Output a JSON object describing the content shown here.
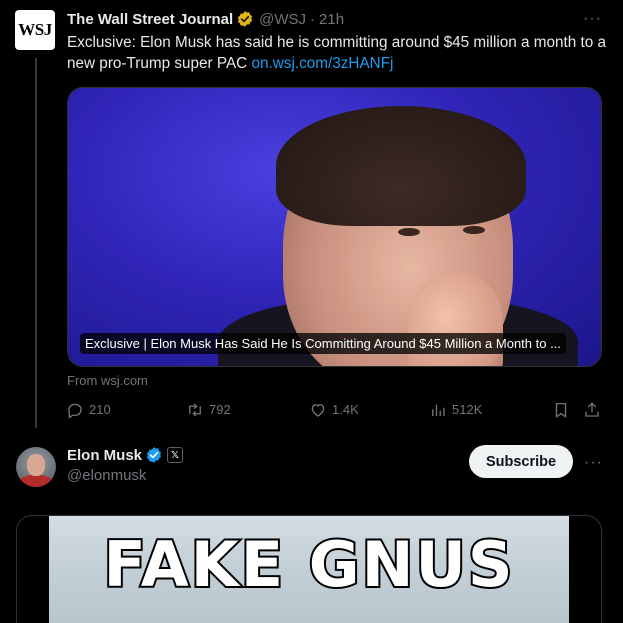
{
  "tweet1": {
    "avatar_text": "WSJ",
    "name": "The Wall Street Journal",
    "handle": "@WSJ",
    "separator": "·",
    "time": "21h",
    "text": "Exclusive: Elon Musk has said he is committing around $45 million a month to a new pro-Trump super PAC ",
    "link": "on.wsj.com/3zHANFj",
    "media_caption": "Exclusive | Elon Musk Has Said He Is Committing Around $45 Million a Month to ...",
    "from": "From wsj.com",
    "actions": {
      "replies": "210",
      "reposts": "792",
      "likes": "1.4K",
      "views": "512K"
    },
    "more": "···"
  },
  "tweet2": {
    "name": "Elon Musk",
    "handle": "@elonmusk",
    "affiliate_badge": "𝕏",
    "subscribe_label": "Subscribe",
    "more": "···",
    "media_text": "FAKE GNUS"
  },
  "colors": {
    "background": "#000000",
    "text": "#e7e9ea",
    "muted": "#71767b",
    "link": "#1d9bf0",
    "verified_gold": "#e2b719",
    "verified_blue": "#1d9bf0",
    "border": "#2f3336"
  },
  "icons": [
    "wsj-logo",
    "gold-verified-icon",
    "blue-verified-icon",
    "more-icon",
    "reply-icon",
    "repost-icon",
    "like-icon",
    "views-icon",
    "bookmark-icon",
    "share-icon",
    "x-affiliate-icon"
  ]
}
